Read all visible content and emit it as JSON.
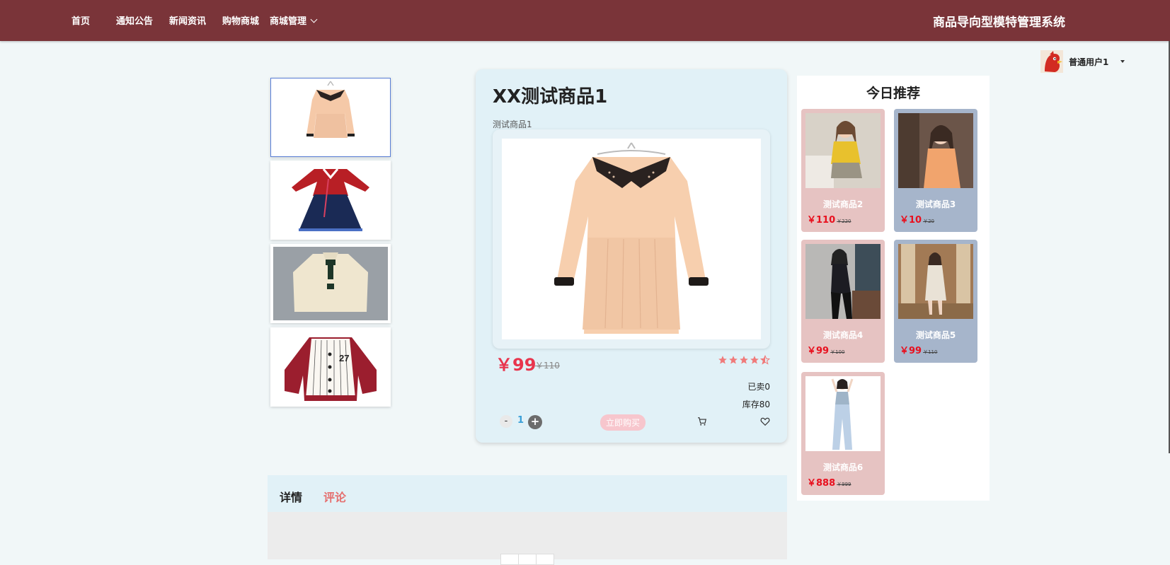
{
  "nav": {
    "items": [
      {
        "label": "首页"
      },
      {
        "label": "通知公告"
      },
      {
        "label": "新闻资讯"
      },
      {
        "label": "购物商城"
      },
      {
        "label": "商城管理"
      }
    ],
    "site_title": "商品导向型模特管理系统"
  },
  "user": {
    "name": "普通用户1",
    "avatar_icon": "user-avatar-icon"
  },
  "product": {
    "title": "XX测试商品1",
    "subtitle": "测试商品1",
    "price": "￥99",
    "original_price": "￥110",
    "rating": 4.5,
    "sold": "已卖0",
    "stock": "库存80",
    "quantity": "1",
    "buy_label": "立即购买",
    "icons": {
      "cart": "cart-icon",
      "favorite": "heart-icon",
      "star": "star-icon"
    }
  },
  "recommend": {
    "title": "今日推荐",
    "items": [
      {
        "name": "测试商品2",
        "price": "￥110",
        "old_price": "￥220",
        "bg": "#e6c3c2"
      },
      {
        "name": "测试商品3",
        "price": "￥10",
        "old_price": "￥20",
        "bg": "#a6b5cb"
      },
      {
        "name": "测试商品4",
        "price": "￥99",
        "old_price": "￥100",
        "bg": "#e6c3c2"
      },
      {
        "name": "测试商品5",
        "price": "￥99",
        "old_price": "￥110",
        "bg": "#a6b5cb"
      },
      {
        "name": "测试商品6",
        "price": "￥888",
        "old_price": "￥999",
        "bg": "#e6c3c2"
      }
    ]
  },
  "tabs": [
    {
      "label": "详情"
    },
    {
      "label": "评论"
    }
  ],
  "colors": {
    "topbar": "#7a3439",
    "price": "#e8354d",
    "accent_blue": "#3aa0d8",
    "comment_tab": "#e56f6f"
  }
}
